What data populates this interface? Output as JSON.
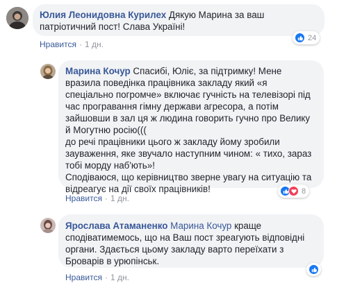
{
  "comments": [
    {
      "author": "Юлия Леонидовна Курилех",
      "text_lines": [
        " Дякую Марина за ваш",
        "патріотичний пост! Слава Україні!"
      ],
      "like_label": "Нравится",
      "time": "1 дн.",
      "reaction_count": "24",
      "reactions": [
        "like-icon"
      ]
    },
    {
      "author": "Марина Кочур",
      "text_lines": [
        " Спасибі, Юліє, за підтримку! Мене",
        "вразила поведінка працівника закладу який «я",
        "спеціально погромче» включає гучність на телевізорі під",
        "час програвання гімну держави агресора, а потім",
        "зайшовши в зал ця ж людина говорить гучно про Велику",
        "й Могутню росію(((",
        "до речі працівники цього ж закладу йому зробили",
        "зауваження, яке звучало наступним чином: « тихо, зараз",
        "тобі морду наб'ють»!",
        "Сподіваюся, що керівництво зверне увагу на ситуацію та",
        "відреагує на дії своїх працівників!"
      ],
      "like_label": "Нравится",
      "time": "1 дн.",
      "reaction_count": "8",
      "reactions": [
        "like-icon",
        "love-icon"
      ]
    },
    {
      "author": "Ярослава Атаманенко",
      "mention": "Марина Кочур",
      "text_lines": [
        " краще",
        "сподіватимемось, що на Ваш пост зреагують відповідні",
        "органи. Здається цьому закладу варто переїхати з",
        "Броварів в урюпінськ."
      ],
      "like_label": "Нравится",
      "time": "1 дн.",
      "reaction_count": "",
      "reactions": [
        "like-icon"
      ]
    }
  ],
  "colors": {
    "link": "#385898",
    "bubble": "#f2f3f5",
    "meta": "#90949c",
    "like": "#1877f2",
    "love": "#f33e58"
  }
}
